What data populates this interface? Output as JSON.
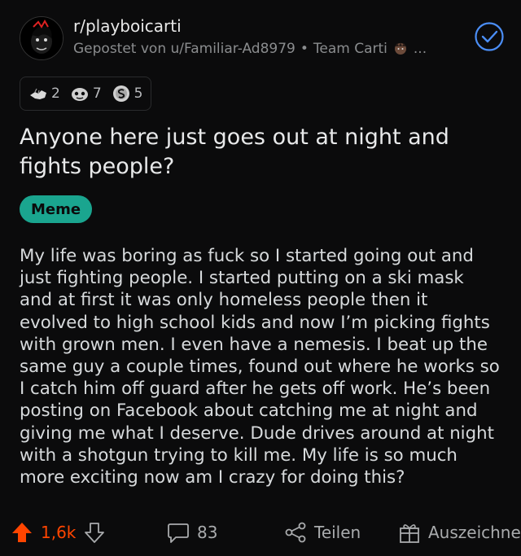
{
  "post": {
    "subreddit": "r/playboicarti",
    "posted_by": "Gepostet von u/Familiar-Ad8979",
    "separator": "•",
    "user_flair": "Team Carti",
    "more": "...",
    "awards": [
      {
        "icon": "fist-bump-award-icon",
        "count": "2"
      },
      {
        "icon": "helpful-award-icon",
        "count": "7"
      },
      {
        "icon": "silver-award-icon",
        "count": "5"
      }
    ],
    "title": "Anyone here just goes out at night and fights people?",
    "tag": "Meme",
    "body": "My life was boring as fuck so I started going out and just fighting people. I started putting on a ski mask and at first it was only homeless people then it evolved to high school kids and now I’m picking fights with grown men. I even have a nemesis. I beat up the same guy a couple times, found out where he works so I catch him off guard after he gets off work. He’s been posting on Facebook about catching me at night and giving me what I deserve. Dude drives around at night with a shotgun trying to kill me. My life is so much more exciting now am I crazy for doing this?"
  },
  "actions": {
    "upvotes": "1,6k",
    "comments": "83",
    "share_label": "Teilen",
    "award_label": "Auszeichnen"
  },
  "colors": {
    "background": "#0b0b0c",
    "upvote": "#ff4500",
    "tag": "#1aa58f",
    "check": "#4b8ef6"
  }
}
